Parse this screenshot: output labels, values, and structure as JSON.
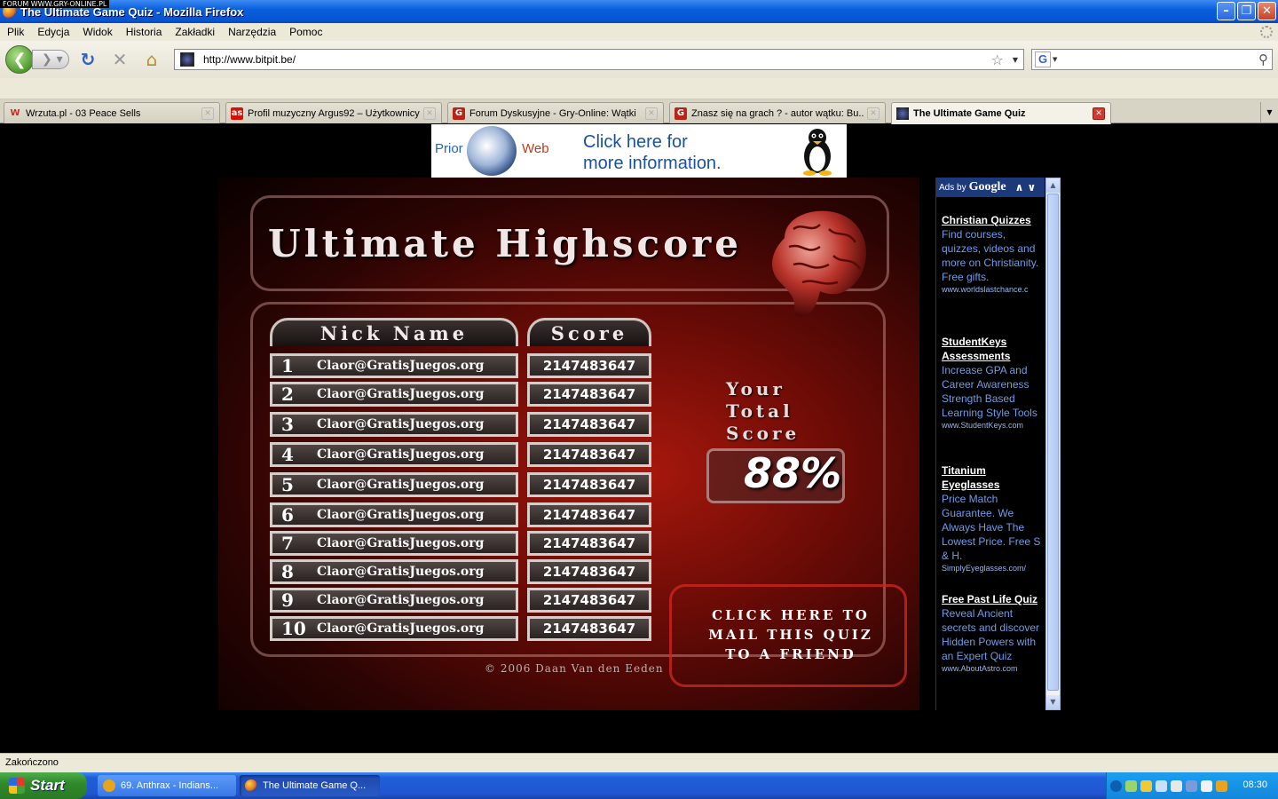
{
  "watermark": "FORUM WWW.GRY-ONLINE.PL",
  "window": {
    "title": "The Ultimate Game Quiz - Mozilla Firefox"
  },
  "menu": [
    "Plik",
    "Edycja",
    "Widok",
    "Historia",
    "Zakładki",
    "Narzędzia",
    "Pomoc"
  ],
  "nav": {
    "url": "http://www.bitpit.be/",
    "search_engine": "G"
  },
  "tabs": [
    {
      "label": "Wrzuta.pl - 03 Peace Sells",
      "icon": "W",
      "color": "#cc2a1a"
    },
    {
      "label": "Profil muzyczny Argus92 – Użytkownicy...",
      "icon": "as",
      "color": "#d51007"
    },
    {
      "label": "Forum Dyskusyjne - Gry-Online: Wątki",
      "icon": "G",
      "color": "#b8241a"
    },
    {
      "label": "Znasz się na grach ? - autor wątku: Bu...",
      "icon": "G",
      "color": "#b8241a"
    },
    {
      "label": "The Ultimate Game Quiz",
      "icon": "",
      "color": "#333366"
    }
  ],
  "banner": {
    "prior": "Prior",
    "web": "Web",
    "line1": "Click here for",
    "line2": "more information."
  },
  "game": {
    "title": "Ultimate Highscore",
    "header_nick": "Nick Name",
    "header_score": "Score",
    "rows": [
      {
        "rank": "1",
        "nick": "Claor@GratisJuegos.org",
        "score": "2147483647"
      },
      {
        "rank": "2",
        "nick": "Claor@GratisJuegos.org",
        "score": "2147483647"
      },
      {
        "rank": "3",
        "nick": "Claor@GratisJuegos.org",
        "score": "2147483647"
      },
      {
        "rank": "4",
        "nick": "Claor@GratisJuegos.org",
        "score": "2147483647"
      },
      {
        "rank": "5",
        "nick": "Claor@GratisJuegos.org",
        "score": "2147483647"
      },
      {
        "rank": "6",
        "nick": "Claor@GratisJuegos.org",
        "score": "2147483647"
      },
      {
        "rank": "7",
        "nick": "Claor@GratisJuegos.org",
        "score": "2147483647"
      },
      {
        "rank": "8",
        "nick": "Claor@GratisJuegos.org",
        "score": "2147483647"
      },
      {
        "rank": "9",
        "nick": "Claor@GratisJuegos.org",
        "score": "2147483647"
      },
      {
        "rank": "10",
        "nick": "Claor@GratisJuegos.org",
        "score": "2147483647"
      }
    ],
    "your_total_1": "Your",
    "your_total_2": "Total",
    "your_total_3": "Score",
    "total_pct": "88%",
    "mail_1": "CLICK HERE TO",
    "mail_2": "MAIL THIS QUIZ",
    "mail_3": "TO A FRIEND",
    "copyright": "© 2006 Daan Van den Eeden"
  },
  "ads": {
    "ads_by": "Ads by",
    "google": "Google",
    "items": [
      {
        "title": "Christian Quizzes",
        "text": "Find courses, quizzes, videos and more on Christianity. Free gifts.",
        "url": "www.worldslastchance.c"
      },
      {
        "title": "StudentKeys Assessments",
        "text": "Increase GPA and Career Awareness Strength Based Learning Style Tools",
        "url": "www.StudentKeys.com"
      },
      {
        "title": "Titanium Eyeglasses",
        "text": "Price Match Guarantee. We Always Have The Lowest Price. Free S & H.",
        "url": "SimplyEyeglasses.com/"
      },
      {
        "title": "Free Past Life Quiz",
        "text": "Reveal Ancient secrets and discover Hidden Powers with an Expert Quiz",
        "url": "www.AboutAstro.com"
      }
    ]
  },
  "status": "Zakończono",
  "taskbar": {
    "start": "Start",
    "task1": "69. Anthrax - Indians...",
    "task2": "The Ultimate Game Q...",
    "clock": "08:30"
  }
}
